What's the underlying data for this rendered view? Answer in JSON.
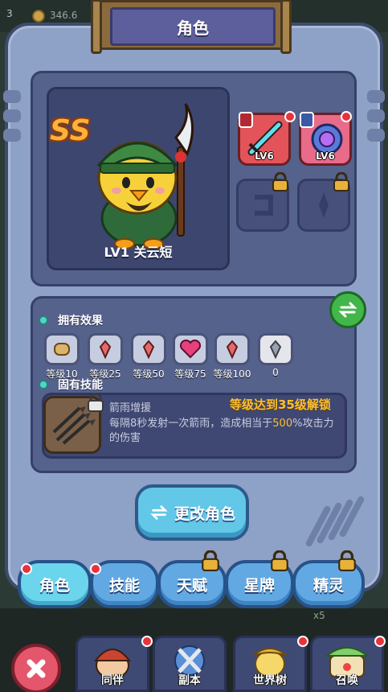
{
  "status_bar": {
    "level": "3",
    "coins": "346.6"
  },
  "panel": {
    "title": "角色"
  },
  "hero": {
    "grade": "SS",
    "name": "LV1  关云短"
  },
  "equipment": [
    {
      "name": "sword",
      "level": "LV6",
      "color": "#e2545a",
      "locked": false
    },
    {
      "name": "orb",
      "level": "LV6",
      "color": "#e86b8a",
      "locked": false
    },
    {
      "name": "slot-3",
      "level": "",
      "locked": true
    },
    {
      "name": "slot-4",
      "level": "",
      "locked": true
    }
  ],
  "effects": {
    "label": "拥有效果",
    "items": [
      {
        "icon": "scroll-icon",
        "label": "等级10"
      },
      {
        "icon": "red-gem-icon",
        "label": "等级25"
      },
      {
        "icon": "red-gem-icon",
        "label": "等级50"
      },
      {
        "icon": "heart-icon",
        "label": "等级75"
      },
      {
        "icon": "red-gem-icon",
        "label": "等级100"
      },
      {
        "icon": "grey-gem-icon",
        "label": "0"
      }
    ]
  },
  "skill": {
    "label": "固有技能",
    "name": "箭雨增援",
    "unlock": "等级达到35级解锁",
    "desc_pre": "每隔8秒发射一次箭雨，造成相当于",
    "desc_pct": "500",
    "desc_post": "%攻击力的伤害"
  },
  "change_button": {
    "label": "更改角色"
  },
  "tabs": [
    {
      "label": "角色",
      "active": true,
      "locked": false
    },
    {
      "label": "技能",
      "active": false,
      "locked": false
    },
    {
      "label": "天赋",
      "active": false,
      "locked": true
    },
    {
      "label": "星牌",
      "active": false,
      "locked": true
    },
    {
      "label": "精灵",
      "active": false,
      "locked": true
    }
  ],
  "bottom_nav": [
    {
      "label": "同伴"
    },
    {
      "label": "副本"
    },
    {
      "label": "世界树"
    },
    {
      "label": "召唤"
    }
  ],
  "colors": {
    "accent_orange": "#ffbf2e",
    "panel": "#8ea1c6",
    "tab_active": "#6ad5ec"
  }
}
